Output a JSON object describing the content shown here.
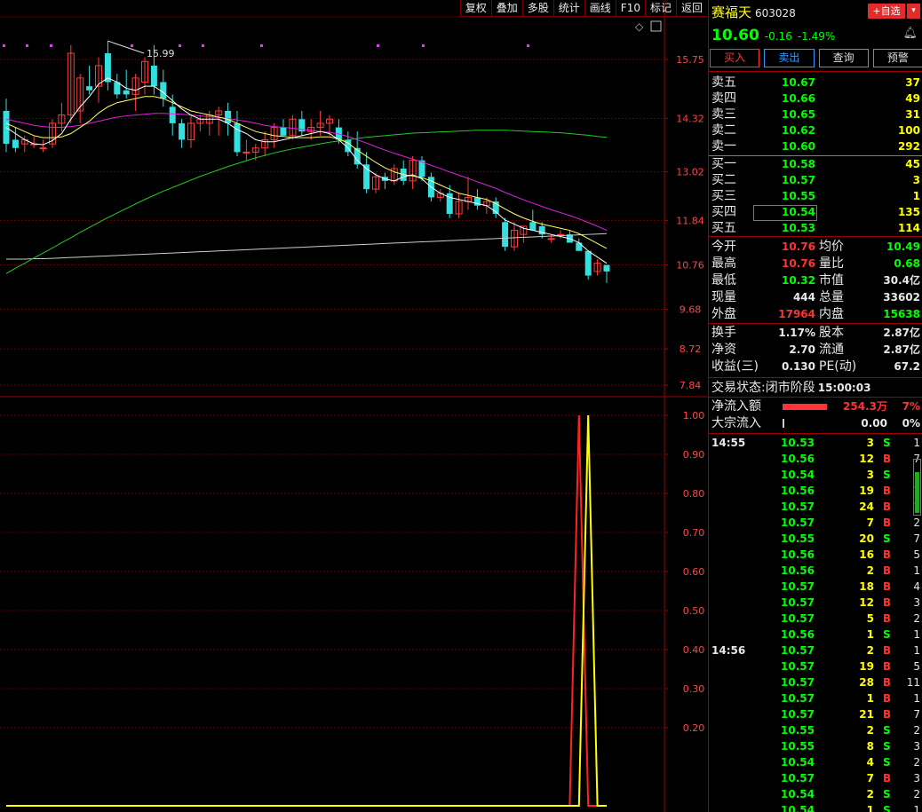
{
  "toolbar": [
    "复权",
    "叠加",
    "多股",
    "统计",
    "画线",
    "F10",
    "标记",
    "返回"
  ],
  "stock": {
    "name": "赛福天",
    "code": "603028",
    "price": "10.60",
    "change": "-0.16",
    "pct": "-1.49%"
  },
  "header_buttons": {
    "add": "+自选",
    "add_menu": "▾"
  },
  "actions": [
    "买入",
    "卖出",
    "查询",
    "预警"
  ],
  "asks": [
    {
      "label": "卖五",
      "price": "10.67",
      "vol": "37"
    },
    {
      "label": "卖四",
      "price": "10.66",
      "vol": "49"
    },
    {
      "label": "卖三",
      "price": "10.65",
      "vol": "31"
    },
    {
      "label": "卖二",
      "price": "10.62",
      "vol": "100"
    },
    {
      "label": "卖一",
      "price": "10.60",
      "vol": "292"
    }
  ],
  "bids": [
    {
      "label": "买一",
      "price": "10.58",
      "vol": "45"
    },
    {
      "label": "买二",
      "price": "10.57",
      "vol": "3"
    },
    {
      "label": "买三",
      "price": "10.55",
      "vol": "1"
    },
    {
      "label": "买四",
      "price": "10.54",
      "vol": "135"
    },
    {
      "label": "买五",
      "price": "10.53",
      "vol": "114"
    }
  ],
  "stats1": [
    {
      "l1": "今开",
      "v1": "10.76",
      "c1": "r",
      "l2": "均价",
      "v2": "10.49",
      "c2": "g"
    },
    {
      "l1": "最高",
      "v1": "10.76",
      "c1": "r",
      "l2": "量比",
      "v2": "0.68",
      "c2": "g"
    },
    {
      "l1": "最低",
      "v1": "10.32",
      "c1": "g",
      "l2": "市值",
      "v2": "30.4亿",
      "c2": "w"
    },
    {
      "l1": "现量",
      "v1": "444",
      "c1": "w",
      "l2": "总量",
      "v2": "33602",
      "c2": "w"
    },
    {
      "l1": "外盘",
      "v1": "17964",
      "c1": "r",
      "l2": "内盘",
      "v2": "15638",
      "c2": "g"
    }
  ],
  "stats2": [
    {
      "l1": "换手",
      "v1": "1.17%",
      "c1": "w",
      "l2": "股本",
      "v2": "2.87亿",
      "c2": "w"
    },
    {
      "l1": "净资",
      "v1": "2.70",
      "c1": "w",
      "l2": "流通",
      "v2": "2.87亿",
      "c2": "w"
    },
    {
      "l1": "收益(三)",
      "v1": "0.130",
      "c1": "w",
      "l2": "PE(动)",
      "v2": "67.2",
      "c2": "w"
    }
  ],
  "trade_status": {
    "label": "交易状态:",
    "phase": "闭市阶段",
    "time": "15:00:03"
  },
  "flows": [
    {
      "label": "净流入额",
      "value": "254.3万",
      "pct": "7%"
    },
    {
      "label": "大宗流入",
      "value": "0.00",
      "pct": "0%"
    }
  ],
  "ticks": [
    {
      "t": "14:55",
      "p": "10.53",
      "v": "3",
      "d": "S",
      "n": "1"
    },
    {
      "t": "",
      "p": "10.56",
      "v": "12",
      "d": "B",
      "n": "7"
    },
    {
      "t": "",
      "p": "10.54",
      "v": "3",
      "d": "S",
      "n": ""
    },
    {
      "t": "",
      "p": "10.56",
      "v": "19",
      "d": "B",
      "n": "1"
    },
    {
      "t": "",
      "p": "10.57",
      "v": "24",
      "d": "B",
      "n": "1"
    },
    {
      "t": "",
      "p": "10.57",
      "v": "7",
      "d": "B",
      "n": "2"
    },
    {
      "t": "",
      "p": "10.55",
      "v": "20",
      "d": "S",
      "n": "7"
    },
    {
      "t": "",
      "p": "10.56",
      "v": "16",
      "d": "B",
      "n": "5"
    },
    {
      "t": "",
      "p": "10.56",
      "v": "2",
      "d": "B",
      "n": "1"
    },
    {
      "t": "",
      "p": "10.57",
      "v": "18",
      "d": "B",
      "n": "4"
    },
    {
      "t": "",
      "p": "10.57",
      "v": "12",
      "d": "B",
      "n": "3"
    },
    {
      "t": "",
      "p": "10.57",
      "v": "5",
      "d": "B",
      "n": "2"
    },
    {
      "t": "",
      "p": "10.56",
      "v": "1",
      "d": "S",
      "n": "1"
    },
    {
      "t": "14:56",
      "p": "10.57",
      "v": "2",
      "d": "B",
      "n": "1"
    },
    {
      "t": "",
      "p": "10.57",
      "v": "19",
      "d": "B",
      "n": "5"
    },
    {
      "t": "",
      "p": "10.57",
      "v": "28",
      "d": "B",
      "n": "11"
    },
    {
      "t": "",
      "p": "10.57",
      "v": "1",
      "d": "B",
      "n": "1"
    },
    {
      "t": "",
      "p": "10.57",
      "v": "21",
      "d": "B",
      "n": "7"
    },
    {
      "t": "",
      "p": "10.55",
      "v": "2",
      "d": "S",
      "n": "2"
    },
    {
      "t": "",
      "p": "10.55",
      "v": "8",
      "d": "S",
      "n": "3"
    },
    {
      "t": "",
      "p": "10.54",
      "v": "4",
      "d": "S",
      "n": "2"
    },
    {
      "t": "",
      "p": "10.57",
      "v": "7",
      "d": "B",
      "n": "3"
    },
    {
      "t": "",
      "p": "10.54",
      "v": "2",
      "d": "S",
      "n": "2"
    },
    {
      "t": "",
      "p": "10.54",
      "v": "1",
      "d": "S",
      "n": "1"
    }
  ],
  "chart_data": [
    {
      "type": "candlestick",
      "y_ticks": [
        15.75,
        14.32,
        13.02,
        11.84,
        10.76,
        9.68,
        8.72,
        7.84
      ],
      "high_label": "15.99",
      "candles": [
        {
          "o": 14.5,
          "h": 14.8,
          "l": 13.5,
          "c": 13.7
        },
        {
          "o": 13.8,
          "h": 14.1,
          "l": 13.5,
          "c": 13.6
        },
        {
          "o": 13.7,
          "h": 13.9,
          "l": 13.5,
          "c": 13.8
        },
        {
          "o": 13.7,
          "h": 13.9,
          "l": 13.6,
          "c": 13.7
        },
        {
          "o": 13.6,
          "h": 13.8,
          "l": 13.5,
          "c": 13.6
        },
        {
          "o": 13.7,
          "h": 14.3,
          "l": 13.6,
          "c": 14.2
        },
        {
          "o": 14.2,
          "h": 14.7,
          "l": 14.0,
          "c": 14.4
        },
        {
          "o": 14.4,
          "h": 16.1,
          "l": 14.2,
          "c": 15.9
        },
        {
          "o": 14.5,
          "h": 15.4,
          "l": 14.2,
          "c": 15.3
        },
        {
          "o": 15.1,
          "h": 15.6,
          "l": 14.9,
          "c": 15.0
        },
        {
          "o": 15.1,
          "h": 15.8,
          "l": 14.7,
          "c": 15.6
        },
        {
          "o": 15.9,
          "h": 16.2,
          "l": 15.0,
          "c": 15.2
        },
        {
          "o": 15.2,
          "h": 15.4,
          "l": 14.8,
          "c": 14.9
        },
        {
          "o": 15.0,
          "h": 15.5,
          "l": 14.8,
          "c": 14.9
        },
        {
          "o": 14.9,
          "h": 15.4,
          "l": 14.5,
          "c": 15.3
        },
        {
          "o": 15.2,
          "h": 15.8,
          "l": 14.9,
          "c": 15.7
        },
        {
          "o": 15.6,
          "h": 16.1,
          "l": 14.9,
          "c": 15.1
        },
        {
          "o": 15.2,
          "h": 15.5,
          "l": 14.6,
          "c": 14.8
        },
        {
          "o": 14.6,
          "h": 14.9,
          "l": 13.9,
          "c": 14.2
        },
        {
          "o": 14.2,
          "h": 14.3,
          "l": 13.6,
          "c": 13.8
        },
        {
          "o": 13.8,
          "h": 14.4,
          "l": 13.6,
          "c": 14.2
        },
        {
          "o": 14.2,
          "h": 14.4,
          "l": 14.0,
          "c": 14.3
        },
        {
          "o": 14.2,
          "h": 14.5,
          "l": 13.9,
          "c": 14.4
        },
        {
          "o": 14.4,
          "h": 14.6,
          "l": 13.9,
          "c": 14.5
        },
        {
          "o": 14.5,
          "h": 14.7,
          "l": 13.9,
          "c": 14.2
        },
        {
          "o": 14.2,
          "h": 14.5,
          "l": 13.4,
          "c": 13.5
        },
        {
          "o": 13.5,
          "h": 13.8,
          "l": 13.3,
          "c": 13.5
        },
        {
          "o": 13.5,
          "h": 13.7,
          "l": 13.3,
          "c": 13.6
        },
        {
          "o": 13.6,
          "h": 14.0,
          "l": 13.4,
          "c": 13.8
        },
        {
          "o": 13.8,
          "h": 14.2,
          "l": 13.6,
          "c": 14.1
        },
        {
          "o": 14.1,
          "h": 14.3,
          "l": 13.9,
          "c": 13.9
        },
        {
          "o": 13.9,
          "h": 14.4,
          "l": 13.8,
          "c": 14.3
        },
        {
          "o": 14.3,
          "h": 14.5,
          "l": 13.9,
          "c": 14.0
        },
        {
          "o": 14.0,
          "h": 14.3,
          "l": 13.8,
          "c": 14.1
        },
        {
          "o": 14.1,
          "h": 14.5,
          "l": 13.9,
          "c": 14.2
        },
        {
          "o": 14.2,
          "h": 14.4,
          "l": 13.9,
          "c": 14.3
        },
        {
          "o": 14.1,
          "h": 14.3,
          "l": 13.7,
          "c": 13.8
        },
        {
          "o": 13.8,
          "h": 14.0,
          "l": 13.4,
          "c": 13.5
        },
        {
          "o": 13.6,
          "h": 14.0,
          "l": 13.1,
          "c": 13.2
        },
        {
          "o": 13.2,
          "h": 13.5,
          "l": 12.5,
          "c": 12.6
        },
        {
          "o": 12.6,
          "h": 13.0,
          "l": 12.5,
          "c": 12.9
        },
        {
          "o": 12.9,
          "h": 13.0,
          "l": 12.6,
          "c": 12.8
        },
        {
          "o": 12.8,
          "h": 13.2,
          "l": 12.7,
          "c": 13.1
        },
        {
          "o": 13.1,
          "h": 13.3,
          "l": 12.7,
          "c": 12.8
        },
        {
          "o": 12.8,
          "h": 13.4,
          "l": 12.6,
          "c": 13.3
        },
        {
          "o": 13.3,
          "h": 13.4,
          "l": 12.8,
          "c": 12.9
        },
        {
          "o": 12.9,
          "h": 13.0,
          "l": 12.3,
          "c": 12.4
        },
        {
          "o": 12.4,
          "h": 12.6,
          "l": 12.3,
          "c": 12.5
        },
        {
          "o": 12.5,
          "h": 12.7,
          "l": 11.9,
          "c": 12.0
        },
        {
          "o": 12.0,
          "h": 12.5,
          "l": 11.9,
          "c": 12.3
        },
        {
          "o": 12.3,
          "h": 12.9,
          "l": 12.1,
          "c": 12.4
        },
        {
          "o": 12.4,
          "h": 12.6,
          "l": 12.1,
          "c": 12.2
        },
        {
          "o": 12.2,
          "h": 12.4,
          "l": 12.0,
          "c": 12.3
        },
        {
          "o": 12.3,
          "h": 12.4,
          "l": 11.9,
          "c": 12.0
        },
        {
          "o": 11.8,
          "h": 11.9,
          "l": 11.1,
          "c": 11.2
        },
        {
          "o": 11.2,
          "h": 11.8,
          "l": 11.1,
          "c": 11.6
        },
        {
          "o": 11.5,
          "h": 11.7,
          "l": 11.3,
          "c": 11.7
        },
        {
          "o": 11.8,
          "h": 12.1,
          "l": 11.6,
          "c": 11.6
        },
        {
          "o": 11.7,
          "h": 11.8,
          "l": 11.4,
          "c": 11.5
        },
        {
          "o": 11.4,
          "h": 11.5,
          "l": 11.3,
          "c": 11.4
        },
        {
          "o": 11.5,
          "h": 11.6,
          "l": 11.4,
          "c": 11.5
        },
        {
          "o": 11.5,
          "h": 11.6,
          "l": 11.3,
          "c": 11.3
        },
        {
          "o": 11.3,
          "h": 11.4,
          "l": 11.1,
          "c": 11.1
        },
        {
          "o": 11.1,
          "h": 11.1,
          "l": 10.4,
          "c": 10.5
        },
        {
          "o": 10.6,
          "h": 10.9,
          "l": 10.5,
          "c": 10.8
        },
        {
          "o": 10.76,
          "h": 10.76,
          "l": 10.32,
          "c": 10.6
        }
      ],
      "ma5": [
        14.1,
        13.95,
        13.8,
        13.7,
        13.68,
        13.78,
        13.95,
        14.3,
        14.6,
        14.85,
        15.15,
        15.3,
        15.2,
        15.05,
        15.0,
        15.1,
        15.1,
        14.95,
        14.75,
        14.55,
        14.4,
        14.3,
        14.3,
        14.3,
        14.2,
        14.05,
        13.95,
        13.8,
        13.75,
        13.75,
        13.8,
        13.85,
        13.9,
        13.95,
        14.0,
        13.95,
        13.8,
        13.6,
        13.3,
        13.1,
        12.95,
        12.85,
        12.8,
        12.9,
        12.95,
        12.85,
        12.65,
        12.5,
        12.4,
        12.35,
        12.3,
        12.25,
        12.2,
        12.05,
        11.85,
        11.75,
        11.65,
        11.6,
        11.55,
        11.5,
        11.45,
        11.4,
        11.3,
        11.1,
        10.95,
        10.8
      ],
      "ma10": [
        14.2,
        14.1,
        14.0,
        13.9,
        13.85,
        13.85,
        13.87,
        13.95,
        14.1,
        14.25,
        14.45,
        14.6,
        14.7,
        14.75,
        14.8,
        14.85,
        14.85,
        14.8,
        14.7,
        14.6,
        14.5,
        14.45,
        14.4,
        14.35,
        14.3,
        14.2,
        14.1,
        14.0,
        13.95,
        13.9,
        13.88,
        13.85,
        13.85,
        13.85,
        13.87,
        13.87,
        13.82,
        13.72,
        13.55,
        13.4,
        13.25,
        13.12,
        13.02,
        12.95,
        12.92,
        12.88,
        12.8,
        12.7,
        12.6,
        12.5,
        12.45,
        12.4,
        12.35,
        12.25,
        12.12,
        12.0,
        11.9,
        11.82,
        11.75,
        11.7,
        11.65,
        11.6,
        11.52,
        11.4,
        11.28,
        11.16
      ],
      "ma20": [
        14.3,
        14.25,
        14.2,
        14.15,
        14.12,
        14.1,
        14.1,
        14.12,
        14.15,
        14.2,
        14.25,
        14.3,
        14.35,
        14.38,
        14.4,
        14.42,
        14.44,
        14.44,
        14.43,
        14.42,
        14.4,
        14.38,
        14.36,
        14.34,
        14.32,
        14.28,
        14.25,
        14.2,
        14.15,
        14.12,
        14.1,
        14.08,
        14.05,
        14.03,
        14.0,
        13.98,
        13.94,
        13.88,
        13.8,
        13.72,
        13.63,
        13.55,
        13.47,
        13.4,
        13.33,
        13.26,
        13.18,
        13.1,
        13.02,
        12.94,
        12.86,
        12.78,
        12.7,
        12.62,
        12.52,
        12.43,
        12.34,
        12.26,
        12.18,
        12.1,
        12.03,
        11.96,
        11.88,
        11.79,
        11.7,
        11.6
      ],
      "ma60": [
        10.55,
        10.68,
        10.8,
        10.93,
        11.05,
        11.17,
        11.3,
        11.42,
        11.55,
        11.67,
        11.79,
        11.91,
        12.02,
        12.13,
        12.24,
        12.35,
        12.45,
        12.55,
        12.64,
        12.73,
        12.82,
        12.91,
        12.99,
        13.07,
        13.15,
        13.22,
        13.29,
        13.36,
        13.42,
        13.48,
        13.53,
        13.58,
        13.62,
        13.66,
        13.7,
        13.74,
        13.77,
        13.8,
        13.83,
        13.86,
        13.88,
        13.9,
        13.92,
        13.94,
        13.96,
        13.97,
        13.98,
        13.99,
        14.0,
        14.01,
        14.02,
        14.03,
        14.03,
        14.03,
        14.03,
        14.02,
        14.01,
        14.0,
        13.99,
        13.98,
        13.97,
        13.95,
        13.93,
        13.91,
        13.88,
        13.86
      ],
      "ma250": [
        10.9,
        10.9,
        10.9,
        10.91,
        10.91,
        10.92,
        10.93,
        10.94,
        10.95,
        10.96,
        10.97,
        10.98,
        10.99,
        11.0,
        11.01,
        11.02,
        11.03,
        11.04,
        11.05,
        11.06,
        11.07,
        11.08,
        11.09,
        11.1,
        11.11,
        11.12,
        11.13,
        11.14,
        11.15,
        11.16,
        11.17,
        11.18,
        11.19,
        11.2,
        11.21,
        11.22,
        11.23,
        11.24,
        11.25,
        11.26,
        11.27,
        11.28,
        11.29,
        11.3,
        11.31,
        11.32,
        11.33,
        11.34,
        11.35,
        11.36,
        11.37,
        11.38,
        11.39,
        11.4,
        11.41,
        11.42,
        11.43,
        11.44,
        11.45,
        11.46,
        11.47,
        11.48,
        11.49,
        11.5,
        11.51,
        11.52
      ]
    },
    {
      "type": "line",
      "y_ticks": [
        1.0,
        0.9,
        0.8,
        0.7,
        0.6,
        0.5,
        0.4,
        0.3,
        0.2
      ],
      "ylim": [
        0,
        1
      ],
      "series": [
        {
          "color": "#ff2222",
          "values": [
            0,
            0,
            0,
            0,
            0,
            0,
            0,
            0,
            0,
            0,
            0,
            0,
            0,
            0,
            0,
            0,
            0,
            0,
            0,
            0,
            0,
            0,
            0,
            0,
            0,
            0,
            0,
            0,
            0,
            0,
            0,
            0,
            0,
            0,
            0,
            0,
            0,
            0,
            0,
            0,
            0,
            0,
            0,
            0,
            0,
            0,
            0,
            0,
            0,
            0,
            0,
            0,
            0,
            0,
            0,
            0,
            0,
            0,
            0,
            0,
            0,
            0,
            1,
            0,
            0,
            0
          ]
        },
        {
          "color": "#ffff00",
          "values": [
            0,
            0,
            0,
            0,
            0,
            0,
            0,
            0,
            0,
            0,
            0,
            0,
            0,
            0,
            0,
            0,
            0,
            0,
            0,
            0,
            0,
            0,
            0,
            0,
            0,
            0,
            0,
            0,
            0,
            0,
            0,
            0,
            0,
            0,
            0,
            0,
            0,
            0,
            0,
            0,
            0,
            0,
            0,
            0,
            0,
            0,
            0,
            0,
            0,
            0,
            0,
            0,
            0,
            0,
            0,
            0,
            0,
            0,
            0,
            0,
            0,
            0,
            0,
            1,
            0,
            0
          ]
        }
      ]
    }
  ]
}
